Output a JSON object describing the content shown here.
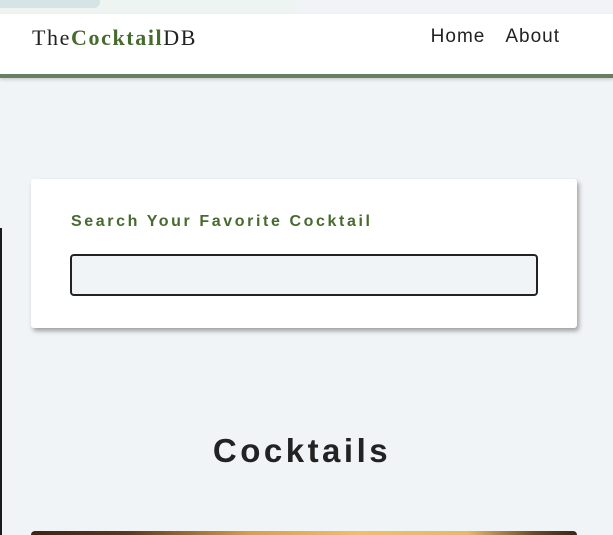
{
  "brand": {
    "prefix": "The",
    "middle": "Cocktail",
    "suffix": "DB"
  },
  "nav": {
    "links": [
      "Home",
      "About"
    ]
  },
  "search": {
    "label": "Search Your Favorite Cocktail",
    "value": "",
    "placeholder": ""
  },
  "section": {
    "title": "Cocktails"
  },
  "colors": {
    "accent_green": "#476a2f",
    "nav_border": "#6a7d60",
    "background": "#f0f4f7",
    "text": "#222222"
  }
}
